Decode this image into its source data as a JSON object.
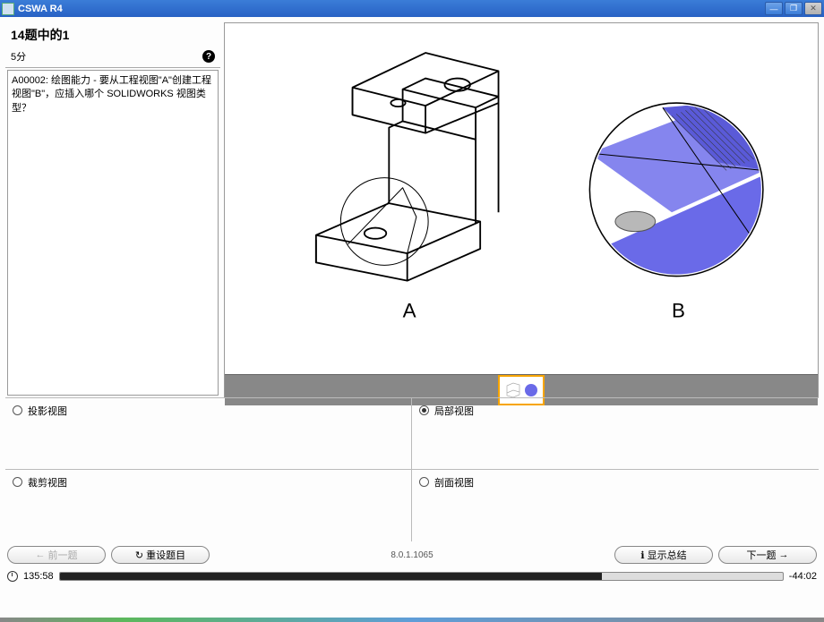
{
  "window": {
    "title": "CSWA R4"
  },
  "question": {
    "counter": "14题中的1",
    "points": "5分",
    "text": "A00002: 绘图能力 - 要从工程视图\"A\"创建工程视图\"B\"，应插入哪个 SOLIDWORKS 视图类型？"
  },
  "labels": {
    "a": "A",
    "b": "B"
  },
  "answers": [
    {
      "label": "投影视图",
      "checked": false
    },
    {
      "label": "局部视图",
      "checked": true
    },
    {
      "label": "裁剪视图",
      "checked": false
    },
    {
      "label": "剖面视图",
      "checked": false
    }
  ],
  "buttons": {
    "prev": "前一题",
    "reset": "重设题目",
    "summary": "显示总结",
    "next": "下一题"
  },
  "version": "8.0.1.1065",
  "timer": {
    "elapsed": "135:58",
    "remaining": "-44:02",
    "progress_pct": 75
  }
}
